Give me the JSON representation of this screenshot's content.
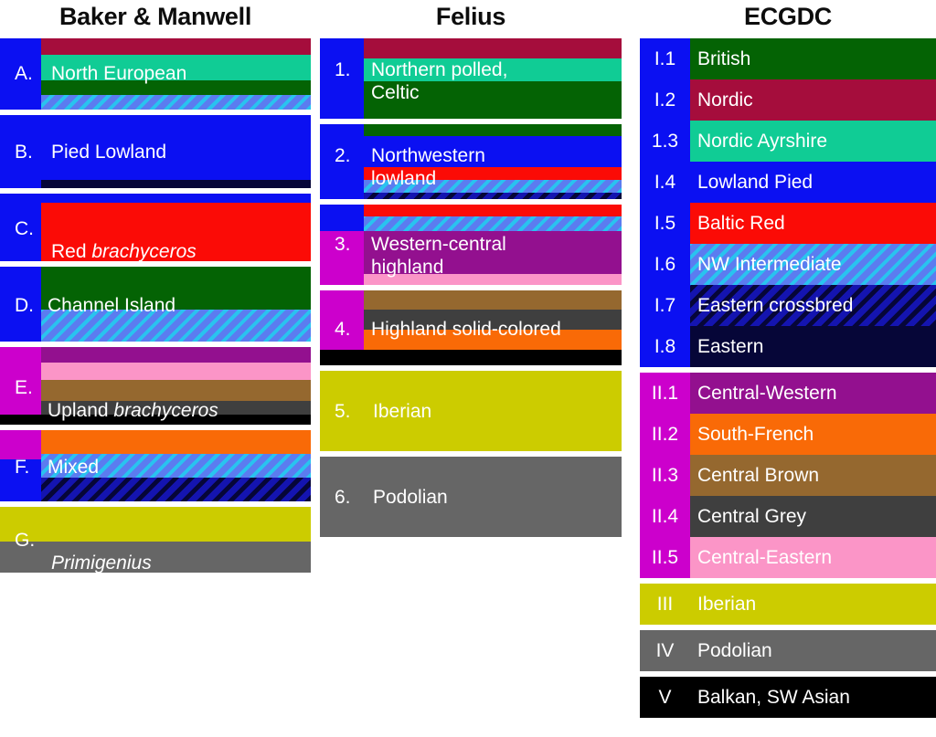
{
  "palette": {
    "blue": "#0b10f2",
    "magenta": "#cc00cc",
    "maroon": "#a50d3c",
    "spring_green": "#10cc95",
    "dark_green": "#046304",
    "red": "#fb0b06",
    "purple": "#93108f",
    "pink": "#fb95c7",
    "brown": "#95682f",
    "dark_grey": "#3f3f3f",
    "grey": "#666666",
    "black": "#000000",
    "orange": "#f96a07",
    "olive": "#cccc00",
    "navy": "#060638",
    "hatch_light_blue": "#5b7cf0",
    "hatch_dark_blue": "#1414b0",
    "text_white": "#ffffff",
    "title_black": "#0d0d0d"
  },
  "columns": {
    "baker": {
      "title": "Baker & Manwell",
      "rows": [
        {
          "label": "A.",
          "name": "North European",
          "italic": ""
        },
        {
          "label": "B.",
          "name": "Pied Lowland",
          "italic": ""
        },
        {
          "label": "C.",
          "name": "Red ",
          "italic": "brachyceros"
        },
        {
          "label": "D.",
          "name": "Channel Island",
          "italic": ""
        },
        {
          "label": "E.",
          "name": "Upland ",
          "italic": "brachyceros"
        },
        {
          "label": "F.",
          "name": "Mixed",
          "italic": ""
        },
        {
          "label": "G.",
          "name": "",
          "italic": "Primigenius"
        }
      ]
    },
    "felius": {
      "title": "Felius",
      "rows": [
        {
          "label": "1.",
          "name": "Northern polled,\nCeltic"
        },
        {
          "label": "2.",
          "name": "Northwestern\nlowland"
        },
        {
          "label": "3.",
          "name": "Western-central\nhighland"
        },
        {
          "label": "4.",
          "name": "Highland solid-colored"
        },
        {
          "label": "5.",
          "name": "Iberian"
        },
        {
          "label": "6.",
          "name": "Podolian"
        }
      ]
    },
    "ecgdc": {
      "title": "ECGDC",
      "groups": [
        {
          "gutter_color": "#0b10f2",
          "rows": [
            {
              "label": "I.1",
              "name": "British",
              "fill": "#046304",
              "pattern": "solid"
            },
            {
              "label": "I.2",
              "name": "Nordic",
              "fill": "#a50d3c",
              "pattern": "solid"
            },
            {
              "label": "1.3",
              "name": "Nordic Ayrshire",
              "fill": "#10cc95",
              "pattern": "solid"
            },
            {
              "label": "I.4",
              "name": "Lowland Pied",
              "fill": "#0b10f2",
              "pattern": "solid"
            },
            {
              "label": "I.5",
              "name": "Baltic Red",
              "fill": "#fb0b06",
              "pattern": "solid"
            },
            {
              "label": "I.6",
              "name": "NW Intermediate",
              "fill": "#5b7cf0",
              "pattern": "hatch-light"
            },
            {
              "label": "I.7",
              "name": "Eastern crossbred",
              "fill": "#1414b0",
              "pattern": "hatch-dark"
            },
            {
              "label": "I.8",
              "name": "Eastern",
              "fill": "#060638",
              "pattern": "solid"
            }
          ]
        },
        {
          "gutter_color": "#cc00cc",
          "rows": [
            {
              "label": "II.1",
              "name": "Central-Western",
              "fill": "#93108f",
              "pattern": "solid"
            },
            {
              "label": "II.2",
              "name": "South-French",
              "fill": "#f96a07",
              "pattern": "solid"
            },
            {
              "label": "II.3",
              "name": "Central Brown",
              "fill": "#95682f",
              "pattern": "solid"
            },
            {
              "label": "II.4",
              "name": "Central Grey",
              "fill": "#3f3f3f",
              "pattern": "solid"
            },
            {
              "label": "II.5",
              "name": "Central-Eastern",
              "fill": "#fb95c7",
              "pattern": "solid"
            }
          ]
        },
        {
          "gutter_color": "",
          "rows": [
            {
              "label": "III",
              "name": "Iberian",
              "fill": "#cccc00",
              "pattern": "solid"
            }
          ]
        },
        {
          "gutter_color": "",
          "rows": [
            {
              "label": "IV",
              "name": "Podolian",
              "fill": "#666666",
              "pattern": "solid"
            }
          ]
        },
        {
          "gutter_color": "",
          "rows": [
            {
              "label": "V",
              "name": "Balkan, SW Asian",
              "fill": "#000000",
              "pattern": "solid"
            }
          ]
        }
      ]
    }
  }
}
